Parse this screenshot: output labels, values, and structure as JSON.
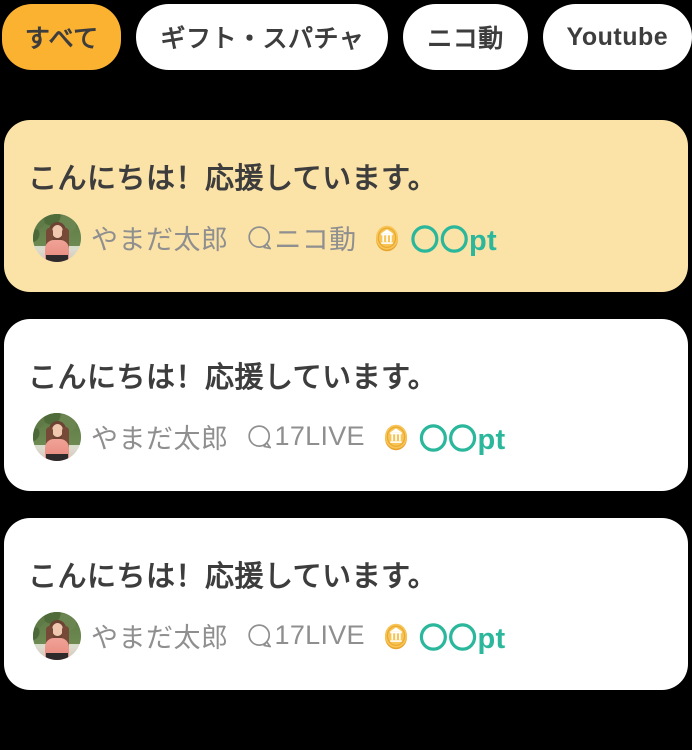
{
  "tabs": [
    {
      "label": "すべて",
      "active": true
    },
    {
      "label": "ギフト・スパチャ",
      "active": false
    },
    {
      "label": "ニコ動",
      "active": false
    },
    {
      "label": "Youtube",
      "active": false
    }
  ],
  "colors": {
    "active_tab_bg": "#fbb231",
    "tab_bg": "#ffffff",
    "tab_text": "#3d3d3d",
    "highlight_card_bg": "#fbe2a7",
    "card_bg": "#ffffff",
    "message_text": "#3d3d3d",
    "meta_text": "#8f8f8f",
    "points_text": "#2bb79b",
    "coin": "#f5b841",
    "page_bg": "#000000"
  },
  "cards": [
    {
      "message": "こんにちは！応援しています。",
      "user": "やまだ太郎",
      "platform": "ニコ動",
      "platform_icon": "speech-bubble-icon",
      "coin_icon": "bank-coin-icon",
      "points": "〇〇pt",
      "highlighted": true
    },
    {
      "message": "こんにちは！応援しています。",
      "user": "やまだ太郎",
      "platform": "17LIVE",
      "platform_icon": "speech-bubble-icon",
      "coin_icon": "bank-coin-icon",
      "points": "〇〇pt",
      "highlighted": false
    },
    {
      "message": "こんにちは！応援しています。",
      "user": "やまだ太郎",
      "platform": "17LIVE",
      "platform_icon": "speech-bubble-icon",
      "coin_icon": "bank-coin-icon",
      "points": "〇〇pt",
      "highlighted": false
    }
  ]
}
